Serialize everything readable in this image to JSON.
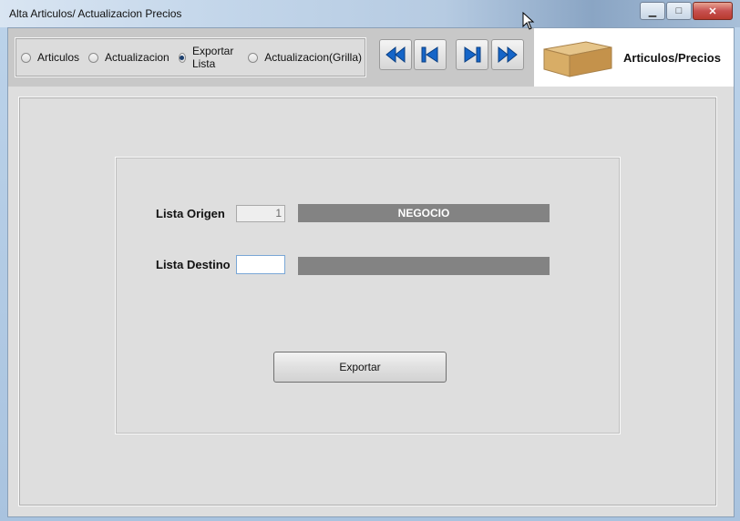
{
  "window": {
    "title": "Alta Articulos/ Actualizacion Precios"
  },
  "toolbar": {
    "radios": [
      {
        "label": "Articulos",
        "selected": false
      },
      {
        "label": "Actualizacion",
        "selected": false
      },
      {
        "label": "Exportar Lista",
        "selected": true
      },
      {
        "label": "Actualizacion(Grilla)",
        "selected": false
      }
    ],
    "nav_icons": [
      "first-record-icon",
      "previous-record-icon",
      "next-record-icon",
      "last-record-icon"
    ],
    "brand_label": "Articulos/Precios",
    "brand_icon": "box-icon"
  },
  "form": {
    "origen_label": "Lista Origen",
    "origen_value": "1",
    "origen_name": "NEGOCIO",
    "destino_label": "Lista Destino",
    "destino_value": "",
    "destino_name": "",
    "export_button": "Exportar"
  },
  "colors": {
    "accent": "#1565c8",
    "bar": "#838383",
    "panel": "#dedede"
  }
}
